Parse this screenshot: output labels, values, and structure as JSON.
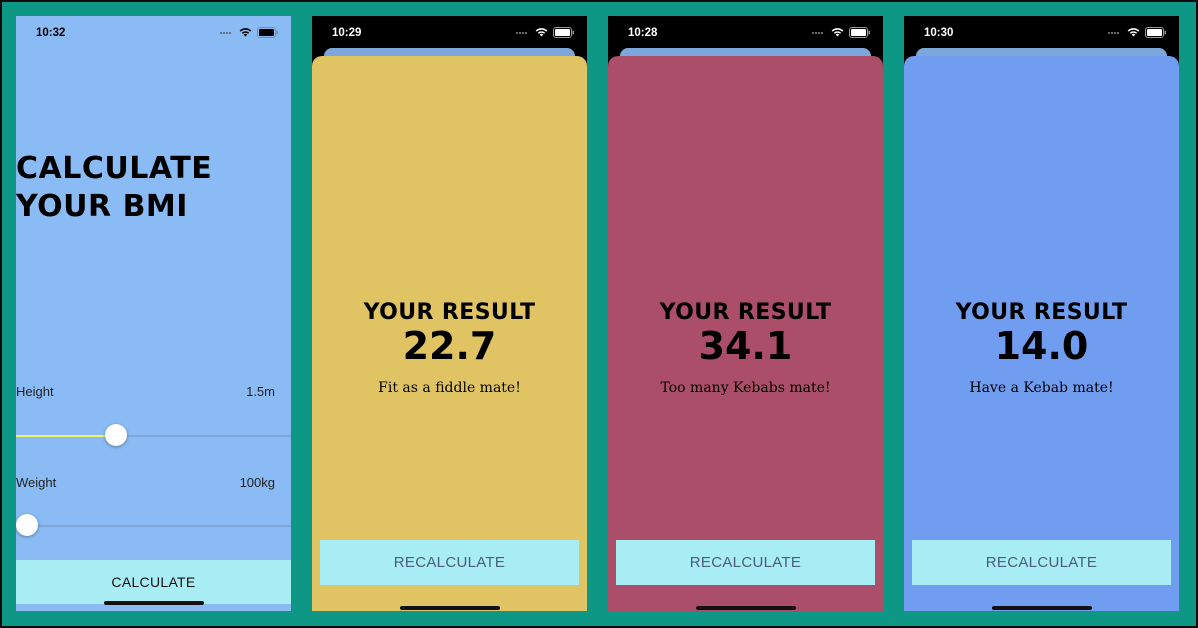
{
  "screens": {
    "input": {
      "time": "10:32",
      "title_line1": "CALCULATE",
      "title_line2": "YOUR BMI",
      "height_label": "Height",
      "height_value": "1.5m",
      "height_slider_fraction": 0.35,
      "weight_label": "Weight",
      "weight_value": "100kg",
      "weight_slider_fraction": 0.0,
      "calculate_label": "CALCULATE"
    },
    "results": [
      {
        "time": "10:29",
        "title": "YOUR RESULT",
        "value": "22.7",
        "advice": "Fit as a fiddle mate!",
        "recalculate_label": "RECALCULATE",
        "color": "#e0c464"
      },
      {
        "time": "10:28",
        "title": "YOUR RESULT",
        "value": "34.1",
        "advice": "Too many Kebabs mate!",
        "recalculate_label": "RECALCULATE",
        "color": "#ab4e69"
      },
      {
        "time": "10:30",
        "title": "YOUR RESULT",
        "value": "14.0",
        "advice": "Have a Kebab mate!",
        "recalculate_label": "RECALCULATE",
        "color": "#709def"
      }
    ]
  },
  "colors": {
    "background": "#0e9784",
    "input_screen": "#8abbf4",
    "button": "#a8ecf4",
    "slider_fill": "#e8f56a"
  },
  "icons": [
    "signal-dots-icon",
    "wifi-icon",
    "battery-icon"
  ]
}
